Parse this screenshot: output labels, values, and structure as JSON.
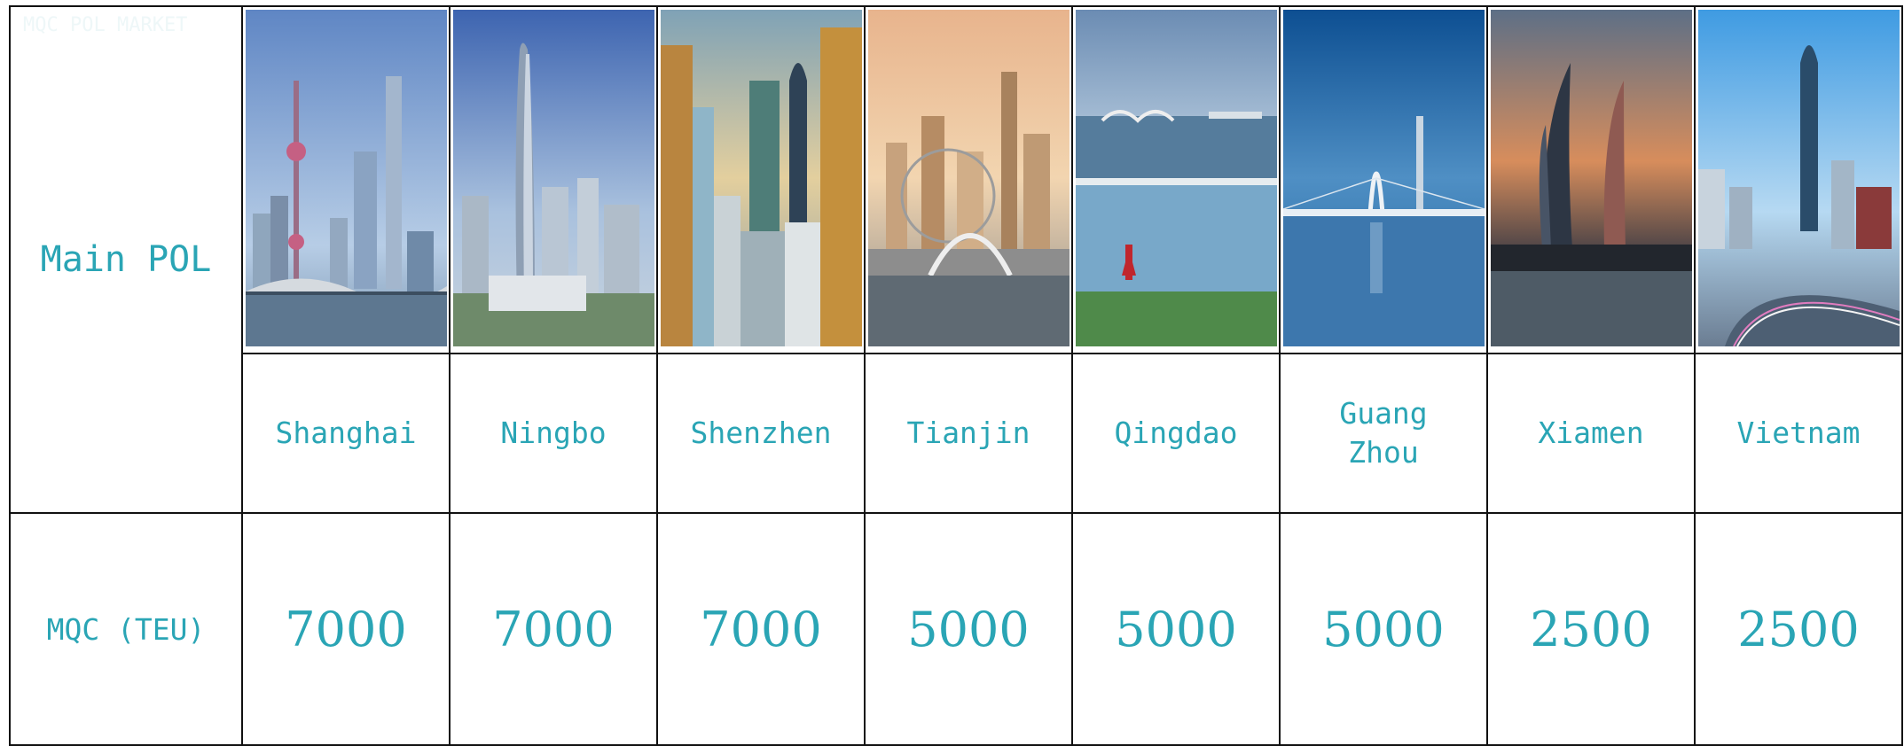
{
  "header_ghost": "MQC  POL  MARKET",
  "row_labels": {
    "pol": "Main POL",
    "mqc": "MQC (TEU)"
  },
  "ports": [
    {
      "name": "Shanghai",
      "mqc": "7000"
    },
    {
      "name": "Ningbo",
      "mqc": "7000"
    },
    {
      "name": "Shenzhen",
      "mqc": "7000"
    },
    {
      "name": "Tianjin",
      "mqc": "5000"
    },
    {
      "name": "Qingdao",
      "mqc": "5000"
    },
    {
      "name": "Guang Zhou",
      "name_lines": [
        "Guang",
        "Zhou"
      ],
      "mqc": "5000"
    },
    {
      "name": "Xiamen",
      "mqc": "2500"
    },
    {
      "name": "Vietnam",
      "mqc": "2500"
    }
  ],
  "colors": {
    "accent": "#2aa5b5",
    "border": "#111111"
  }
}
